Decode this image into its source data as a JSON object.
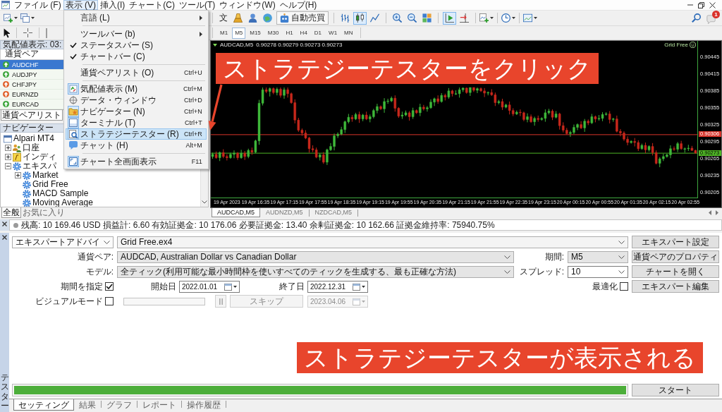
{
  "menu_bar": {
    "items": [
      {
        "label": "ファイル (F)",
        "selected": false
      },
      {
        "label": "表示 (V)",
        "selected": true
      },
      {
        "label": "挿入(I)",
        "selected": false
      },
      {
        "label": "チャート(C)",
        "selected": false
      },
      {
        "label": "ツール(T)",
        "selected": false
      },
      {
        "label": "ウィンドウ(W)",
        "selected": false
      },
      {
        "label": "ヘルプ(H)",
        "selected": false
      }
    ]
  },
  "view_menu": [
    {
      "kind": "submenu",
      "label": "言語 (L)",
      "checked": false,
      "selected": false
    },
    {
      "kind": "separator"
    },
    {
      "kind": "submenu",
      "label": "ツールバー (b)",
      "checked": false,
      "selected": false
    },
    {
      "kind": "toggle",
      "label": "ステータスバー (S)",
      "checked": true,
      "selected": false
    },
    {
      "kind": "toggle",
      "label": "チャートバー (C)",
      "checked": true,
      "selected": false
    },
    {
      "kind": "separator"
    },
    {
      "kind": "command",
      "label": "通貨ペアリスト (O)",
      "shortcut": "Ctrl+U",
      "checked": false,
      "selected": false
    },
    {
      "kind": "separator"
    },
    {
      "kind": "command",
      "label": "気配値表示 (M)",
      "shortcut": "Ctrl+M",
      "checked": true,
      "selected": false
    },
    {
      "kind": "command",
      "label": "データ・ウィンドウ",
      "shortcut": "Ctrl+D",
      "checked": false,
      "selected": false
    },
    {
      "kind": "command",
      "label": "ナビゲーター (N)",
      "shortcut": "Ctrl+N",
      "checked": true,
      "selected": false
    },
    {
      "kind": "command",
      "label": "ターミナル (T)",
      "shortcut": "Ctrl+T",
      "checked": true,
      "selected": false
    },
    {
      "kind": "command",
      "label": "ストラテジーテスター (R)",
      "shortcut": "Ctrl+R",
      "checked": true,
      "selected": true
    },
    {
      "kind": "command",
      "label": "チャット (H)",
      "shortcut": "Alt+M",
      "checked": false,
      "selected": false
    },
    {
      "kind": "separator"
    },
    {
      "kind": "command",
      "label": "チャート全画面表示",
      "shortcut": "F11",
      "checked": true,
      "selected": false
    }
  ],
  "toolbar": {
    "order_button": "文",
    "auto_trading": "自動売買",
    "chart_modes": [
      {
        "selected": false
      },
      {
        "selected": true
      },
      {
        "selected": false
      }
    ],
    "auto_scroll": true,
    "chart_shift": false,
    "notifications": "1"
  },
  "timeframes": [
    {
      "label": "M1",
      "selected": false
    },
    {
      "label": "M5",
      "selected": true
    },
    {
      "label": "M15",
      "selected": false
    },
    {
      "label": "M30",
      "selected": false
    },
    {
      "label": "H1",
      "selected": false
    },
    {
      "label": "H4",
      "selected": false
    },
    {
      "label": "D1",
      "selected": false
    },
    {
      "label": "W1",
      "selected": false
    },
    {
      "label": "MN",
      "selected": false
    }
  ],
  "market_watch": {
    "title": "気配値表示: 03:",
    "column": "通貨ペア",
    "rows": [
      {
        "symbol": "AUDCHF",
        "color": "#3aa53a",
        "selected": true
      },
      {
        "symbol": "AUDJPY",
        "color": "#3aa53a",
        "selected": false
      },
      {
        "symbol": "CHFJPY",
        "color": "#e0602a",
        "selected": false
      },
      {
        "symbol": "EURNZD",
        "color": "#e0602a",
        "selected": false
      },
      {
        "symbol": "EURCAD",
        "color": "#3aa53a",
        "selected": false
      }
    ],
    "tabs": [
      {
        "label": "通貨ペアリスト",
        "selected": true
      }
    ]
  },
  "navigator": {
    "title": "ナビゲーター",
    "tree": [
      {
        "label": "Alpari MT4",
        "children": [
          {
            "label": "口座",
            "expanded": false
          },
          {
            "label": "インディ",
            "expanded": false
          },
          {
            "label": "エキスパ",
            "expanded": true,
            "children": [
              {
                "label": "Market",
                "expanded": false
              },
              {
                "label": "Grid Free"
              },
              {
                "label": "MACD Sample"
              },
              {
                "label": "Moving Average"
              }
            ]
          }
        ]
      }
    ],
    "tabs": [
      {
        "label": "全般",
        "selected": true
      },
      {
        "label": "お気に入り",
        "selected": false
      }
    ]
  },
  "chart": {
    "symbol": "AUDCAD,M5",
    "quotes": "0.90278 0.90279 0.90273 0.90273",
    "expert": "Grid Free",
    "chart_data": {
      "type": "candlestick",
      "categories": [
        null,
        null,
        null,
        null,
        "19 Apr 2023",
        null,
        null,
        null,
        null,
        null,
        null,
        null,
        "19 Apr 16:35",
        null,
        null,
        null,
        null,
        null,
        null,
        null,
        "19 Apr 17:15",
        null,
        null,
        null,
        null,
        null,
        null,
        null,
        "19 Apr 17:55",
        null,
        null,
        null,
        null,
        null,
        null,
        null,
        "19 Apr 18:35",
        null,
        null,
        null,
        null,
        null,
        null,
        null,
        "19 Apr 19:15",
        null,
        null,
        null,
        null,
        null,
        null,
        null,
        "19 Apr 19:55",
        null,
        null,
        null,
        null,
        null,
        null,
        null,
        "19 Apr 20:35",
        null,
        null,
        null,
        null,
        null,
        null,
        null,
        "19 Apr 21:15",
        null,
        null,
        null,
        null,
        null,
        null,
        null,
        "19 Apr 21:55",
        null,
        null,
        null,
        null,
        null,
        null,
        null,
        "19 Apr 22:35",
        null,
        null,
        null,
        null,
        null,
        null,
        null,
        "19 Apr 23:15",
        null,
        null,
        null,
        null,
        null,
        null,
        null,
        "20 Apr 00:15",
        null,
        null,
        null,
        null,
        null,
        null,
        null,
        "20 Apr 00:55",
        null,
        null,
        null,
        null,
        null,
        null,
        null,
        "20 Apr 01:35",
        null,
        null,
        null,
        null,
        null,
        null,
        null,
        "20 Apr 02:15",
        null,
        null,
        null,
        null,
        null,
        null,
        null,
        "20 Apr 02:55",
        null,
        null,
        null
      ],
      "ohlc": [
        [
          0.90267,
          0.90274,
          0.90263,
          0.90271
        ],
        [
          0.90271,
          0.90276,
          0.90263,
          0.90265
        ],
        [
          0.90265,
          0.90276,
          0.90259,
          0.90274
        ],
        [
          0.90274,
          0.9028,
          0.90264,
          0.90267
        ],
        [
          0.90267,
          0.90271,
          0.9026,
          0.90265
        ],
        [
          0.90265,
          0.90274,
          0.90263,
          0.90271
        ],
        [
          0.90271,
          0.90278,
          0.90264,
          0.90273
        ],
        [
          0.90273,
          0.90275,
          0.90261,
          0.90265
        ],
        [
          0.90265,
          0.90279,
          0.90263,
          0.90273
        ],
        [
          0.90273,
          0.90277,
          0.90261,
          0.90267
        ],
        [
          0.90267,
          0.90281,
          0.90264,
          0.90278
        ],
        [
          0.90278,
          0.90283,
          0.9027,
          0.90275
        ],
        [
          0.90275,
          0.90297,
          0.90273,
          0.90295
        ],
        [
          0.90295,
          0.90368,
          0.90288,
          0.90362
        ],
        [
          0.90362,
          0.9039,
          0.90358,
          0.90386
        ],
        [
          0.90386,
          0.9039,
          0.9038,
          0.90383
        ],
        [
          0.90383,
          0.9039,
          0.90374,
          0.90388
        ],
        [
          0.90388,
          0.9039,
          0.90378,
          0.90381
        ],
        [
          0.90381,
          0.9039,
          0.90376,
          0.90387
        ],
        [
          0.90387,
          0.9039,
          0.90372,
          0.90376
        ],
        [
          0.90376,
          0.9039,
          0.9037,
          0.90386
        ],
        [
          0.90386,
          0.9039,
          0.90372,
          0.90379
        ],
        [
          0.90379,
          0.90381,
          0.90361,
          0.90363
        ],
        [
          0.90363,
          0.90369,
          0.90326,
          0.90332
        ],
        [
          0.90332,
          0.90336,
          0.90311,
          0.90314
        ],
        [
          0.90314,
          0.90317,
          0.90304,
          0.90309
        ],
        [
          0.90309,
          0.90314,
          0.90298,
          0.903
        ],
        [
          0.903,
          0.90302,
          0.90274,
          0.90281
        ],
        [
          0.90281,
          0.90287,
          0.90275,
          0.90279
        ],
        [
          0.90279,
          0.90283,
          0.90264,
          0.90266
        ],
        [
          0.90266,
          0.90273,
          0.9026,
          0.9027
        ],
        [
          0.9027,
          0.90275,
          0.90254,
          0.90257
        ],
        [
          0.90257,
          0.90281,
          0.90252,
          0.90279
        ],
        [
          0.90279,
          0.90291,
          0.90277,
          0.90285
        ],
        [
          0.90285,
          0.90308,
          0.90278,
          0.90304
        ],
        [
          0.90304,
          0.9031,
          0.903,
          0.90307
        ],
        [
          0.90307,
          0.9032,
          0.90305,
          0.90315
        ],
        [
          0.90315,
          0.90331,
          0.90309,
          0.90329
        ],
        [
          0.90329,
          0.90343,
          0.90326,
          0.90337
        ],
        [
          0.90337,
          0.90341,
          0.90329,
          0.90334
        ],
        [
          0.90334,
          0.90345,
          0.90332,
          0.90342
        ],
        [
          0.90342,
          0.90347,
          0.90327,
          0.90334
        ],
        [
          0.90334,
          0.90343,
          0.9033,
          0.90341
        ],
        [
          0.90341,
          0.90347,
          0.90332,
          0.90334
        ],
        [
          0.90334,
          0.90342,
          0.90328,
          0.90338
        ],
        [
          0.90338,
          0.90352,
          0.90335,
          0.90349
        ],
        [
          0.90349,
          0.90361,
          0.90344,
          0.90356
        ],
        [
          0.90356,
          0.90358,
          0.9035,
          0.90352
        ],
        [
          0.90352,
          0.90371,
          0.90345,
          0.90365
        ],
        [
          0.90365,
          0.9037,
          0.90361,
          0.90366
        ],
        [
          0.90366,
          0.90374,
          0.90364,
          0.90371
        ],
        [
          0.90371,
          0.90376,
          0.90347,
          0.90353
        ],
        [
          0.90353,
          0.90355,
          0.90336,
          0.90339
        ],
        [
          0.90339,
          0.90347,
          0.90334,
          0.90341
        ],
        [
          0.90341,
          0.90349,
          0.90339,
          0.90345
        ],
        [
          0.90345,
          0.90348,
          0.90331,
          0.90338
        ],
        [
          0.90338,
          0.90354,
          0.90334,
          0.90349
        ],
        [
          0.90349,
          0.90351,
          0.90343,
          0.90345
        ],
        [
          0.90345,
          0.90361,
          0.90339,
          0.90355
        ],
        [
          0.90355,
          0.90359,
          0.90349,
          0.90352
        ],
        [
          0.90352,
          0.90357,
          0.90347,
          0.90354
        ],
        [
          0.90354,
          0.90369,
          0.90352,
          0.90364
        ],
        [
          0.90364,
          0.90372,
          0.90357,
          0.9037
        ],
        [
          0.9037,
          0.90376,
          0.90361,
          0.90365
        ],
        [
          0.90365,
          0.9038,
          0.90363,
          0.90376
        ],
        [
          0.90376,
          0.90379,
          0.90367,
          0.90373
        ],
        [
          0.90373,
          0.90389,
          0.9037,
          0.90384
        ],
        [
          0.90384,
          0.90386,
          0.90374,
          0.90379
        ],
        [
          0.90379,
          0.90385,
          0.90377,
          0.90379
        ],
        [
          0.90379,
          0.9039,
          0.90372,
          0.90386
        ],
        [
          0.90386,
          0.9039,
          0.90382,
          0.90389
        ],
        [
          0.90389,
          0.9039,
          0.90379,
          0.90381
        ],
        [
          0.90381,
          0.9039,
          0.90375,
          0.9039
        ],
        [
          0.9039,
          0.9039,
          0.90382,
          0.90385
        ],
        [
          0.90385,
          0.9039,
          0.9038,
          0.90388
        ],
        [
          0.90388,
          0.9039,
          0.90382,
          0.90384
        ],
        [
          0.90384,
          0.90389,
          0.90373,
          0.9038
        ],
        [
          0.9038,
          0.90383,
          0.90376,
          0.90381
        ],
        [
          0.90381,
          0.90387,
          0.90375,
          0.90377
        ],
        [
          0.90377,
          0.90381,
          0.90357,
          0.90363
        ],
        [
          0.90363,
          0.90368,
          0.9036,
          0.90365
        ],
        [
          0.90365,
          0.9037,
          0.9035,
          0.90355
        ],
        [
          0.90355,
          0.90361,
          0.90353,
          0.90359
        ],
        [
          0.90359,
          0.90365,
          0.90342,
          0.90349
        ],
        [
          0.90349,
          0.90353,
          0.90339,
          0.90343
        ],
        [
          0.90343,
          0.90349,
          0.90341,
          0.90346
        ],
        [
          0.90346,
          0.90351,
          0.90339,
          0.90345
        ],
        [
          0.90345,
          0.90347,
          0.9033,
          0.90333
        ],
        [
          0.90333,
          0.90344,
          0.90328,
          0.90338
        ],
        [
          0.90338,
          0.90342,
          0.90327,
          0.90329
        ],
        [
          0.90329,
          0.90338,
          0.90322,
          0.90335
        ],
        [
          0.90335,
          0.9034,
          0.90329,
          0.90333
        ],
        [
          0.90333,
          0.90337,
          0.90331,
          0.90335
        ],
        [
          0.90335,
          0.90351,
          0.90329,
          0.90345
        ],
        [
          0.90345,
          0.90352,
          0.90342,
          0.90348
        ],
        [
          0.90348,
          0.90351,
          0.90332,
          0.90337
        ],
        [
          0.90337,
          0.90348,
          0.90335,
          0.90343
        ],
        [
          0.90343,
          0.90345,
          0.90315,
          0.90322
        ],
        [
          0.90322,
          0.90328,
          0.9031,
          0.90314
        ],
        [
          0.90314,
          0.90318,
          0.90306,
          0.90308
        ],
        [
          0.90308,
          0.90313,
          0.90302,
          0.9031
        ],
        [
          0.9031,
          0.90324,
          0.90307,
          0.90319
        ],
        [
          0.90319,
          0.90326,
          0.90314,
          0.90324
        ],
        [
          0.90324,
          0.9033,
          0.90316,
          0.90318
        ],
        [
          0.90318,
          0.90334,
          0.90311,
          0.9033
        ],
        [
          0.9033,
          0.90333,
          0.90323,
          0.90327
        ],
        [
          0.90327,
          0.90343,
          0.90325,
          0.90338
        ],
        [
          0.90338,
          0.9034,
          0.90328,
          0.90334
        ],
        [
          0.90334,
          0.90341,
          0.90331,
          0.90335
        ],
        [
          0.90335,
          0.90346,
          0.9033,
          0.90342
        ],
        [
          0.90342,
          0.90346,
          0.9034,
          0.90343
        ],
        [
          0.90343,
          0.90348,
          0.90326,
          0.90333
        ],
        [
          0.90333,
          0.90336,
          0.90329,
          0.90334
        ],
        [
          0.90334,
          0.9034,
          0.9031,
          0.90312
        ],
        [
          0.90312,
          0.90316,
          0.90303,
          0.90309
        ],
        [
          0.90309,
          0.90312,
          0.90295,
          0.90298
        ],
        [
          0.90298,
          0.90303,
          0.90287,
          0.90292
        ],
        [
          0.90292,
          0.90296,
          0.9029,
          0.90294
        ],
        [
          0.90294,
          0.903,
          0.90285,
          0.90292
        ],
        [
          0.90292,
          0.90296,
          0.90277,
          0.90281
        ],
        [
          0.90281,
          0.9029,
          0.90279,
          0.90287
        ],
        [
          0.90287,
          0.90292,
          0.90273,
          0.90279
        ],
        [
          0.90279,
          0.90287,
          0.90276,
          0.90285
        ],
        [
          0.90285,
          0.90291,
          0.90269,
          0.90274
        ],
        [
          0.90274,
          0.90278,
          0.90253,
          0.90255
        ],
        [
          0.90255,
          0.90266,
          0.90248,
          0.90263
        ],
        [
          0.90263,
          0.90272,
          0.90259,
          0.90267
        ],
        [
          0.90267,
          0.90272,
          0.90265,
          0.9027
        ],
        [
          0.9027,
          0.90287,
          0.90264,
          0.90281
        ],
        [
          0.90281,
          0.90285,
          0.90277,
          0.9028
        ],
        [
          0.9028,
          0.90293,
          0.90275,
          0.9029
        ],
        [
          0.9029,
          0.90295,
          0.90279,
          0.90281
        ],
        [
          0.90281,
          0.90283,
          0.90274,
          0.90281
        ],
        [
          0.90281,
          0.90288,
          0.90277,
          0.90282
        ],
        [
          0.90282,
          0.90286,
          0.90277,
          0.90278
        ],
        [
          0.90278,
          0.90279,
          0.90273,
          0.90273
        ]
      ],
      "ylim": [
        0.90194,
        0.90473
      ],
      "yticks": [
        0.90445,
        0.90415,
        0.90385,
        0.90355,
        0.90325,
        0.90295,
        0.90265,
        0.90235,
        0.90205
      ],
      "ref_lines": [
        {
          "axis": "y",
          "value": 0.90306,
          "label": "0.90306",
          "color": "#d8342a"
        },
        {
          "axis": "y",
          "value": 0.90273,
          "label": "0.90273",
          "color": "#4fb526"
        }
      ]
    }
  },
  "chart_tabs": [
    {
      "label": "AUDCAD,M5",
      "selected": true
    },
    {
      "label": "AUDNZD,M5",
      "selected": false
    },
    {
      "label": "NZDCAD,M5",
      "selected": false
    }
  ],
  "account_line": "残高: 10 169.46 USD 損益計: 6.60 有効証拠金: 10 176.06 必要証拠金: 13.40 余剰証拠金: 10 162.66 証拠金維持率: 75940.75%",
  "tester": {
    "title": "テスター",
    "expert_type": "エキスパートアドバイ",
    "expert_file": "Grid Free.ex4",
    "fields": [
      {
        "label": "通貨ペア:",
        "value": "AUDCAD, Australian Dollar vs Canadian Dollar",
        "kind": "list"
      },
      {
        "label": "モデル:",
        "value": "全ティック(利用可能な最小時間枠を使いすべてのティックを生成する、最も正確な方法)",
        "kind": "list"
      }
    ],
    "side_fields": [
      {
        "label": "期間:",
        "value": "M5",
        "kind": "list"
      },
      {
        "label": "スプレッド:",
        "value": "10",
        "kind": "edit"
      }
    ],
    "buttons": [
      "エキスパート設定",
      "通貨ペアのプロパティ",
      "チャートを開く",
      "エキスパート編集"
    ],
    "use_date": {
      "label": "期間を指定",
      "checked": true
    },
    "dates": [
      {
        "label": "開始日",
        "value": "2022.01.01",
        "disabled": false
      },
      {
        "label": "終了日",
        "value": "2022.12.31",
        "disabled": false
      }
    ],
    "optimization": {
      "label": "最適化",
      "checked": false
    },
    "visual_mode": {
      "label": "ビジュアルモード",
      "checked": false
    },
    "pause": {
      "disabled": true
    },
    "skip": {
      "label": "スキップ",
      "disabled": true
    },
    "skip_date": {
      "value": "2023.04.06",
      "disabled": true
    },
    "progress": {
      "level": 1
    },
    "start": "スタート",
    "tabs": [
      {
        "label": "セッティング",
        "selected": true
      },
      {
        "label": "結果",
        "selected": false
      },
      {
        "label": "グラフ",
        "selected": false
      },
      {
        "label": "レポート",
        "selected": false
      },
      {
        "label": "操作履歴",
        "selected": false
      }
    ]
  },
  "annotations": [
    {
      "text": "ストラテジーテスターをクリック"
    },
    {
      "text": "ストラテジーテスターが表示される"
    }
  ]
}
